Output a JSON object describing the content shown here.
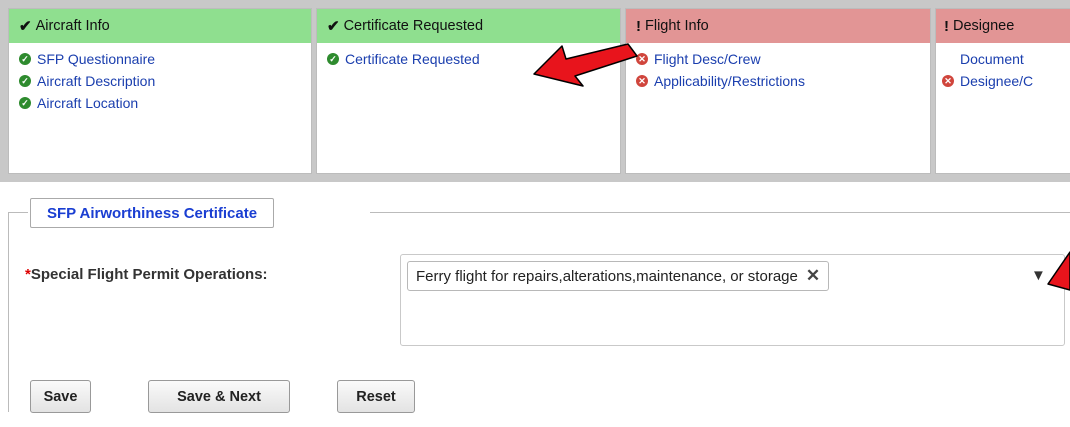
{
  "steps": [
    {
      "title": "Aircraft Info",
      "status": "complete",
      "mark": "✔",
      "items": [
        {
          "label": "SFP Questionnaire",
          "status": "ok",
          "glyph": "✓"
        },
        {
          "label": "Aircraft Description",
          "status": "ok",
          "glyph": "✓"
        },
        {
          "label": "Aircraft Location",
          "status": "ok",
          "glyph": "✓"
        }
      ]
    },
    {
      "title": "Certificate Requested",
      "status": "complete",
      "mark": "✔",
      "items": [
        {
          "label": "Certificate Requested",
          "status": "ok",
          "glyph": "✓"
        }
      ]
    },
    {
      "title": "Flight Info",
      "status": "incomplete",
      "mark": "!",
      "items": [
        {
          "label": "Flight Desc/Crew",
          "status": "error",
          "glyph": "✕"
        },
        {
          "label": "Applicability/Restrictions",
          "status": "error",
          "glyph": "✕"
        }
      ]
    },
    {
      "title": "Designee",
      "status": "incomplete",
      "mark": "!",
      "items": [
        {
          "label": "Document",
          "status": "none",
          "glyph": ""
        },
        {
          "label": "Designee/C",
          "status": "error",
          "glyph": "✕"
        }
      ]
    }
  ],
  "form": {
    "section_title": "SFP Airworthiness Certificate",
    "required_mark": "*",
    "field_label": "Special Flight Permit Operations:",
    "selected_value": "Ferry flight for repairs,alterations,maintenance, or storage",
    "remove_glyph": "✕",
    "dropdown_glyph": "▼"
  },
  "buttons": {
    "save": "Save",
    "save_next": "Save & Next",
    "reset": "Reset"
  },
  "colors": {
    "complete_header": "#8fdf8f",
    "incomplete_header": "#e29595",
    "link": "#1a3eae",
    "section_title": "#1a3ed2",
    "annotation_arrow": "#e8141c"
  }
}
